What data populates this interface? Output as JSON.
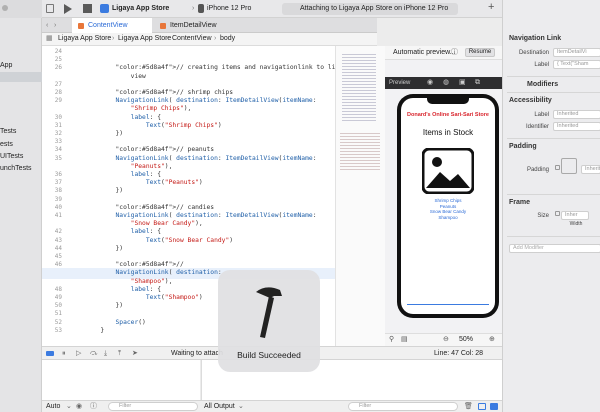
{
  "navigator": {
    "items": [
      {
        "label": "App"
      },
      {
        "label": ""
      },
      {
        "label": "Tests"
      },
      {
        "label": "ests"
      },
      {
        "label": "UITests"
      },
      {
        "label": "unchTests"
      }
    ]
  },
  "toolbar": {
    "scheme": "Ligaya App Store",
    "device": "iPhone 12 Pro",
    "status": "Attaching to Ligaya App Store on iPhone 12 Pro",
    "add_label": "+"
  },
  "tabs": [
    {
      "label": "ContentView"
    },
    {
      "label": "ItemDetailView"
    }
  ],
  "jumpbar": [
    "Ligaya App Store",
    "Ligaya App Store",
    "ContentView",
    "body"
  ],
  "editor": {
    "lines": [
      {
        "n": "24",
        "text": ""
      },
      {
        "n": "25",
        "text": ""
      },
      {
        "n": "26",
        "text": "            // creating items and navigationlink to link the detail"
      },
      {
        "n": "",
        "text": "                view"
      },
      {
        "n": "27",
        "text": ""
      },
      {
        "n": "28",
        "text": "            // shrimp chips"
      },
      {
        "n": "29",
        "text": "            NavigationLink( destination: ItemDetailView(itemName:"
      },
      {
        "n": "",
        "text": "                \"Shrimp Chips\"),"
      },
      {
        "n": "30",
        "text": "                label: {"
      },
      {
        "n": "31",
        "text": "                    Text(\"Shrimp Chips\")"
      },
      {
        "n": "32",
        "text": "            })"
      },
      {
        "n": "33",
        "text": ""
      },
      {
        "n": "34",
        "text": "            // peanuts"
      },
      {
        "n": "35",
        "text": "            NavigationLink( destination: ItemDetailView(itemName:"
      },
      {
        "n": "",
        "text": "                \"Peanuts\"),"
      },
      {
        "n": "36",
        "text": "                label: {"
      },
      {
        "n": "37",
        "text": "                    Text(\"Peanuts\")"
      },
      {
        "n": "38",
        "text": "            })"
      },
      {
        "n": "39",
        "text": ""
      },
      {
        "n": "40",
        "text": "            // candies"
      },
      {
        "n": "41",
        "text": "            NavigationLink( destination: ItemDetailView(itemName:"
      },
      {
        "n": "",
        "text": "                \"Snow Bear Candy\"),"
      },
      {
        "n": "42",
        "text": "                label: {"
      },
      {
        "n": "43",
        "text": "                    Text(\"Snow Bear Candy\")"
      },
      {
        "n": "44",
        "text": "            })"
      },
      {
        "n": "45",
        "text": ""
      },
      {
        "n": "46",
        "text": "            //"
      },
      {
        "n": "47",
        "text": "            NavigationLink( destination:"
      },
      {
        "n": "",
        "text": "                \"Shampoo\"),"
      },
      {
        "n": "48",
        "text": "                label: {"
      },
      {
        "n": "49",
        "text": "                    Text(\"Shampoo\")"
      },
      {
        "n": "50",
        "text": "            })"
      },
      {
        "n": "51",
        "text": ""
      },
      {
        "n": "52",
        "text": "            Spacer()"
      },
      {
        "n": "53",
        "text": "        }"
      }
    ],
    "highlight_line": "47"
  },
  "preview": {
    "header": "Automatic preview...",
    "resume_label": "Resume",
    "bar_label": "Preview",
    "app_title": "Donard's Online Sari-Sari Store",
    "heading": "Items in Stock",
    "links": [
      "Shrimp Chips",
      "Peanuts",
      "Snow Bear Candy",
      "Shampoo"
    ],
    "zoom": "50%"
  },
  "inspector": {
    "nav_link_title": "Navigation Link",
    "destination_label": "Destination",
    "destination_value": "ItemDetailVi",
    "label_label": "Label",
    "label_value": "{ Text(\"Sham",
    "modifiers_title": "Modifiers",
    "accessibility_title": "Accessibility",
    "acc_label": "Label",
    "acc_label_value": "Inherited",
    "identifier_label": "Identifier",
    "identifier_value": "Inherited",
    "padding_title": "Padding",
    "padding_label": "Padding",
    "padding_value": "Inherited",
    "frame_title": "Frame",
    "size_label": "Size",
    "size_value": "Inher",
    "width_label": "Width",
    "add_modifier": "Add Modifier"
  },
  "debug": {
    "status": "Waiting to attach",
    "position": "Line: 47  Col: 28"
  },
  "bottom": {
    "auto_label": "Auto",
    "filter_left": "Filter",
    "output_label": "All Output",
    "filter_right": "Filter"
  },
  "hud": {
    "message": "Build Succeeded"
  }
}
